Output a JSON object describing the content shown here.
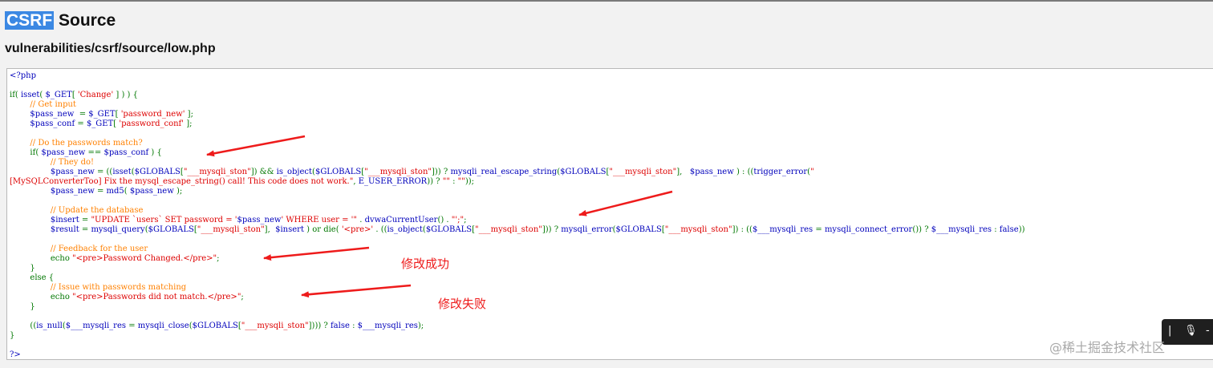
{
  "header": {
    "title_highlight": "CSRF",
    "title_rest": " Source",
    "file_path": "vulnerabilities/csrf/source/low.php"
  },
  "colors": {
    "keyword": "#007700",
    "comment": "#ff8000",
    "string": "#dd0000",
    "default": "#0000bb",
    "annotation": "#ee1b1b",
    "highlight": "#3b88e3"
  },
  "code_lines": [
    {
      "segments": [
        {
          "text": "<?php",
          "c": "default"
        }
      ]
    },
    {
      "segments": []
    },
    {
      "segments": [
        {
          "text": "if( ",
          "c": "keyword"
        },
        {
          "text": "isset",
          "c": "default"
        },
        {
          "text": "( ",
          "c": "keyword"
        },
        {
          "text": "$_GET",
          "c": "default"
        },
        {
          "text": "[ ",
          "c": "keyword"
        },
        {
          "text": "'Change'",
          "c": "string"
        },
        {
          "text": " ] ) ) {",
          "c": "keyword"
        }
      ]
    },
    {
      "segments": [
        {
          "text": "        // Get input",
          "c": "comment"
        }
      ]
    },
    {
      "segments": [
        {
          "text": "        $pass_new  ",
          "c": "default"
        },
        {
          "text": "= ",
          "c": "keyword"
        },
        {
          "text": "$_GET",
          "c": "default"
        },
        {
          "text": "[ ",
          "c": "keyword"
        },
        {
          "text": "'password_new'",
          "c": "string"
        },
        {
          "text": " ];",
          "c": "keyword"
        }
      ]
    },
    {
      "segments": [
        {
          "text": "        $pass_conf ",
          "c": "default"
        },
        {
          "text": "= ",
          "c": "keyword"
        },
        {
          "text": "$_GET",
          "c": "default"
        },
        {
          "text": "[ ",
          "c": "keyword"
        },
        {
          "text": "'password_conf'",
          "c": "string"
        },
        {
          "text": " ];",
          "c": "keyword"
        }
      ]
    },
    {
      "segments": []
    },
    {
      "segments": [
        {
          "text": "        // Do the passwords match?",
          "c": "comment"
        }
      ]
    },
    {
      "segments": [
        {
          "text": "        if( ",
          "c": "keyword"
        },
        {
          "text": "$pass_new ",
          "c": "default"
        },
        {
          "text": "== ",
          "c": "keyword"
        },
        {
          "text": "$pass_conf ",
          "c": "default"
        },
        {
          "text": ") {",
          "c": "keyword"
        }
      ]
    },
    {
      "segments": [
        {
          "text": "                // They do!",
          "c": "comment"
        }
      ]
    },
    {
      "segments": [
        {
          "text": "                $pass_new ",
          "c": "default"
        },
        {
          "text": "= ((",
          "c": "keyword"
        },
        {
          "text": "isset",
          "c": "default"
        },
        {
          "text": "(",
          "c": "keyword"
        },
        {
          "text": "$GLOBALS",
          "c": "default"
        },
        {
          "text": "[",
          "c": "keyword"
        },
        {
          "text": "\"___mysqli_ston\"",
          "c": "string"
        },
        {
          "text": "]) && ",
          "c": "keyword"
        },
        {
          "text": "is_object",
          "c": "default"
        },
        {
          "text": "(",
          "c": "keyword"
        },
        {
          "text": "$GLOBALS",
          "c": "default"
        },
        {
          "text": "[",
          "c": "keyword"
        },
        {
          "text": "\"___mysqli_ston\"",
          "c": "string"
        },
        {
          "text": "])) ? ",
          "c": "keyword"
        },
        {
          "text": "mysqli_real_escape_string",
          "c": "default"
        },
        {
          "text": "(",
          "c": "keyword"
        },
        {
          "text": "$GLOBALS",
          "c": "default"
        },
        {
          "text": "[",
          "c": "keyword"
        },
        {
          "text": "\"___mysqli_ston\"",
          "c": "string"
        },
        {
          "text": "],   ",
          "c": "keyword"
        },
        {
          "text": "$pass_new ",
          "c": "default"
        },
        {
          "text": ") : ((",
          "c": "keyword"
        },
        {
          "text": "trigger_error",
          "c": "default"
        },
        {
          "text": "(",
          "c": "keyword"
        },
        {
          "text": "\"",
          "c": "string"
        }
      ]
    },
    {
      "segments": [
        {
          "text": "[MySQLConverterToo] Fix the mysql_escape_string() call! This code does not work.\"",
          "c": "string"
        },
        {
          "text": ", ",
          "c": "keyword"
        },
        {
          "text": "E_USER_ERROR",
          "c": "default"
        },
        {
          "text": ")) ? ",
          "c": "keyword"
        },
        {
          "text": "\"\"",
          "c": "string"
        },
        {
          "text": " : ",
          "c": "keyword"
        },
        {
          "text": "\"\"",
          "c": "string"
        },
        {
          "text": "));",
          "c": "keyword"
        }
      ]
    },
    {
      "segments": [
        {
          "text": "                $pass_new ",
          "c": "default"
        },
        {
          "text": "= ",
          "c": "keyword"
        },
        {
          "text": "md5",
          "c": "default"
        },
        {
          "text": "( ",
          "c": "keyword"
        },
        {
          "text": "$pass_new ",
          "c": "default"
        },
        {
          "text": ");",
          "c": "keyword"
        }
      ]
    },
    {
      "segments": []
    },
    {
      "segments": [
        {
          "text": "                // Update the database",
          "c": "comment"
        }
      ]
    },
    {
      "segments": [
        {
          "text": "                $insert ",
          "c": "default"
        },
        {
          "text": "= ",
          "c": "keyword"
        },
        {
          "text": "\"UPDATE `users` SET password = '",
          "c": "string"
        },
        {
          "text": "$pass_new",
          "c": "default"
        },
        {
          "text": "' WHERE user = '\"",
          "c": "string"
        },
        {
          "text": " . ",
          "c": "keyword"
        },
        {
          "text": "dvwaCurrentUser",
          "c": "default"
        },
        {
          "text": "() . ",
          "c": "keyword"
        },
        {
          "text": "\"';\"",
          "c": "string"
        },
        {
          "text": ";",
          "c": "keyword"
        }
      ]
    },
    {
      "segments": [
        {
          "text": "                $result ",
          "c": "default"
        },
        {
          "text": "= ",
          "c": "keyword"
        },
        {
          "text": "mysqli_query",
          "c": "default"
        },
        {
          "text": "(",
          "c": "keyword"
        },
        {
          "text": "$GLOBALS",
          "c": "default"
        },
        {
          "text": "[",
          "c": "keyword"
        },
        {
          "text": "\"___mysqli_ston\"",
          "c": "string"
        },
        {
          "text": "],  ",
          "c": "keyword"
        },
        {
          "text": "$insert ",
          "c": "default"
        },
        {
          "text": ") or die( ",
          "c": "keyword"
        },
        {
          "text": "'<pre>'",
          "c": "string"
        },
        {
          "text": " . ((",
          "c": "keyword"
        },
        {
          "text": "is_object",
          "c": "default"
        },
        {
          "text": "(",
          "c": "keyword"
        },
        {
          "text": "$GLOBALS",
          "c": "default"
        },
        {
          "text": "[",
          "c": "keyword"
        },
        {
          "text": "\"___mysqli_ston\"",
          "c": "string"
        },
        {
          "text": "])) ? ",
          "c": "keyword"
        },
        {
          "text": "mysqli_error",
          "c": "default"
        },
        {
          "text": "(",
          "c": "keyword"
        },
        {
          "text": "$GLOBALS",
          "c": "default"
        },
        {
          "text": "[",
          "c": "keyword"
        },
        {
          "text": "\"___mysqli_ston\"",
          "c": "string"
        },
        {
          "text": "]) : ((",
          "c": "keyword"
        },
        {
          "text": "$___mysqli_res ",
          "c": "default"
        },
        {
          "text": "= ",
          "c": "keyword"
        },
        {
          "text": "mysqli_connect_error",
          "c": "default"
        },
        {
          "text": "()) ? ",
          "c": "keyword"
        },
        {
          "text": "$___mysqli_res ",
          "c": "default"
        },
        {
          "text": ": ",
          "c": "keyword"
        },
        {
          "text": "false",
          "c": "default"
        },
        {
          "text": "))",
          "c": "keyword"
        }
      ]
    },
    {
      "segments": []
    },
    {
      "segments": [
        {
          "text": "                // Feedback for the user",
          "c": "comment"
        }
      ]
    },
    {
      "segments": [
        {
          "text": "                echo ",
          "c": "keyword"
        },
        {
          "text": "\"<pre>Password Changed.</pre>\"",
          "c": "string"
        },
        {
          "text": ";",
          "c": "keyword"
        }
      ]
    },
    {
      "segments": [
        {
          "text": "        }",
          "c": "keyword"
        }
      ]
    },
    {
      "segments": [
        {
          "text": "        else {",
          "c": "keyword"
        }
      ]
    },
    {
      "segments": [
        {
          "text": "                // Issue with passwords matching",
          "c": "comment"
        }
      ]
    },
    {
      "segments": [
        {
          "text": "                echo ",
          "c": "keyword"
        },
        {
          "text": "\"<pre>Passwords did not match.</pre>\"",
          "c": "string"
        },
        {
          "text": ";",
          "c": "keyword"
        }
      ]
    },
    {
      "segments": [
        {
          "text": "        }",
          "c": "keyword"
        }
      ]
    },
    {
      "segments": []
    },
    {
      "segments": [
        {
          "text": "        ((",
          "c": "keyword"
        },
        {
          "text": "is_null",
          "c": "default"
        },
        {
          "text": "(",
          "c": "keyword"
        },
        {
          "text": "$___mysqli_res ",
          "c": "default"
        },
        {
          "text": "= ",
          "c": "keyword"
        },
        {
          "text": "mysqli_close",
          "c": "default"
        },
        {
          "text": "(",
          "c": "keyword"
        },
        {
          "text": "$GLOBALS",
          "c": "default"
        },
        {
          "text": "[",
          "c": "keyword"
        },
        {
          "text": "\"___mysqli_ston\"",
          "c": "string"
        },
        {
          "text": "]))) ? ",
          "c": "keyword"
        },
        {
          "text": "false ",
          "c": "default"
        },
        {
          "text": ": ",
          "c": "keyword"
        },
        {
          "text": "$___mysqli_res",
          "c": "default"
        },
        {
          "text": ");",
          "c": "keyword"
        }
      ]
    },
    {
      "segments": [
        {
          "text": "}",
          "c": "keyword"
        }
      ]
    },
    {
      "segments": []
    },
    {
      "segments": [
        {
          "text": "?>",
          "c": "default"
        }
      ]
    }
  ],
  "annotations": {
    "success_label": "修改成功",
    "failure_label": "修改失败"
  },
  "media_bar": {
    "pause_icon": "pause-icon",
    "mic_icon": "mic-icon"
  },
  "watermark": "@稀土掘金技术社区"
}
